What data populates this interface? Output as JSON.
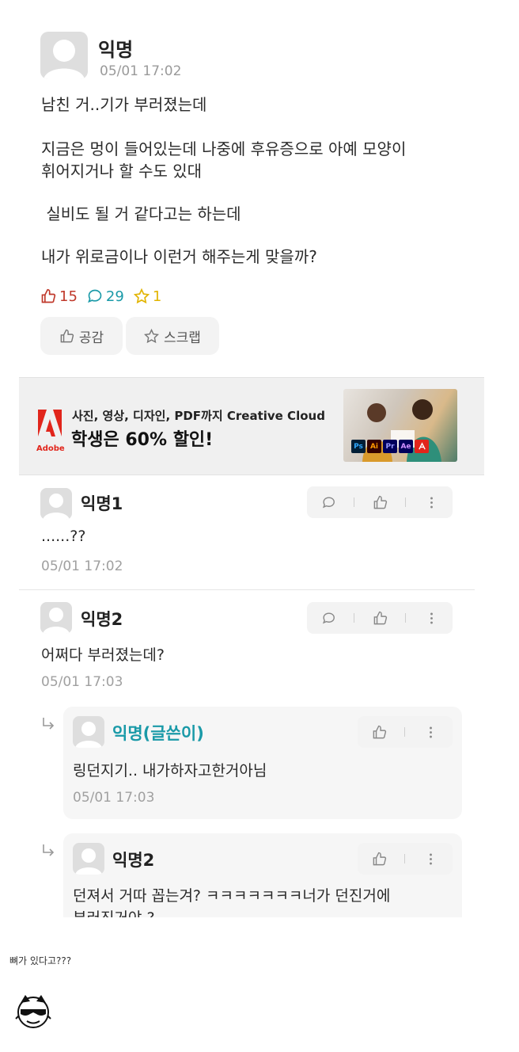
{
  "post": {
    "author": "익명",
    "time": "05/01 17:02",
    "body": [
      "남친 거..기가 부러졌는데",
      "지금은 멍이 들어있는데 나중에 후유증으로 아예 모양이",
      "휘어지거나 할 수도 있대",
      " 실비도 될 거 같다고는 하는데",
      "내가 위로금이나 이런거 해주는게 맞을까?"
    ],
    "stats": {
      "likes": "15",
      "comments": "29",
      "scraps": "1"
    },
    "buttons": {
      "empathy": "공감",
      "scrap": "스크랩"
    }
  },
  "ad": {
    "brand": "Adobe",
    "subtitle": "사진, 영상, 디자인, PDF까지 Creative Cloud",
    "headline": "학생은 60% 할인!",
    "app_badges": [
      "Ps",
      "Ai",
      "Pr",
      "Ae"
    ]
  },
  "comments": [
    {
      "author": "익명1",
      "text": "......??",
      "time": "05/01 17:02"
    },
    {
      "author": "익명2",
      "text": "어쩌다 부러졌는데?",
      "time": "05/01 17:03"
    }
  ],
  "replies": [
    {
      "author": "익명(글쓴이)",
      "text": "링던지기.. 내가하자고한거아님",
      "time": "05/01 17:03"
    },
    {
      "author": "익명2",
      "text": "던져서 거따 꼽는겨? ㅋㅋㅋㅋㅋㅋㅋ너가 던진거에",
      "text2": "부러진거야 ?"
    }
  ],
  "caption": "뼈가 있다고???",
  "colors": {
    "accent": "#1a9aa8",
    "like": "#c0392b",
    "scrap": "#e2b400",
    "adobe": "#e1251b"
  }
}
